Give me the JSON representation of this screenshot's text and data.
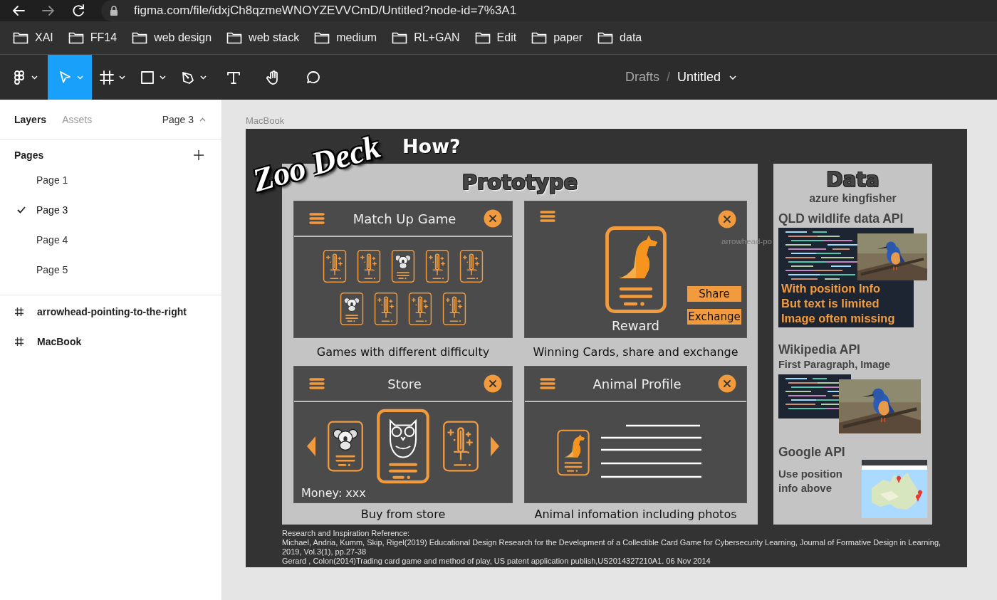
{
  "browser": {
    "url": "figma.com/file/idxjCh8qzmeWNOYZEVVCmD/Untitled?node-id=7%3A1",
    "bookmarks": [
      "XAI",
      "FF14",
      "web design",
      "web stack",
      "medium",
      "RL+GAN",
      "Edit",
      "paper",
      "data"
    ]
  },
  "toolbar": {
    "tools": [
      {
        "kind": "main-menu",
        "selected": false,
        "menu": true
      },
      {
        "kind": "move",
        "selected": true,
        "menu": true
      },
      {
        "kind": "frame",
        "selected": false,
        "menu": true
      },
      {
        "kind": "shape",
        "selected": false,
        "menu": true
      },
      {
        "kind": "pen",
        "selected": false,
        "menu": true
      },
      {
        "kind": "text",
        "selected": false,
        "menu": false
      },
      {
        "kind": "hand",
        "selected": false,
        "menu": false
      },
      {
        "kind": "comment",
        "selected": false,
        "menu": false
      }
    ],
    "breadcrumb": {
      "folder": "Drafts",
      "separator": "/",
      "file": "Untitled"
    }
  },
  "left_panel": {
    "tabs": [
      {
        "label": "Layers",
        "selected": true
      },
      {
        "label": "Assets",
        "selected": false
      }
    ],
    "page_switcher": "Page 3",
    "pages_heading": "Pages",
    "pages": [
      {
        "label": "Page 1",
        "selected": false
      },
      {
        "label": "Page 3",
        "selected": true
      },
      {
        "label": "Page 4",
        "selected": false
      },
      {
        "label": "Page 5",
        "selected": false
      }
    ],
    "layers": [
      "arrowhead-pointing-to-the-right",
      "MacBook"
    ]
  },
  "canvas": {
    "frame_label": "MacBook",
    "overlay_label": "arrowhead-po",
    "slide": {
      "logo": "Zoo Deck",
      "heading": "How?",
      "prototype": {
        "title": "Prototype",
        "screens": [
          {
            "kind": "match",
            "title": "Match Up Game",
            "caption": "Games with different difficulty"
          },
          {
            "kind": "reward",
            "label": "Reward",
            "buttons": [
              "Share",
              "Exchange"
            ],
            "caption": "Winning Cards, share and exchange"
          },
          {
            "kind": "store",
            "title": "Store",
            "money": "Money: xxx",
            "caption": "Buy from store"
          },
          {
            "kind": "profile",
            "title": "Animal Profile",
            "caption": "Animal infomation including photos"
          }
        ]
      },
      "data": {
        "title": "Data",
        "subtitle": "azure kingfisher",
        "sections": [
          {
            "kind": "qld",
            "title": "QLD wildlife data API",
            "note": [
              "With position Info",
              "But text is limited",
              "Image often missing"
            ]
          },
          {
            "kind": "wiki",
            "title": "Wikipedia API",
            "subtitle": "First Paragraph, Image"
          },
          {
            "kind": "map",
            "title": "Google API",
            "subtitle": "Use position info above"
          }
        ]
      },
      "references": {
        "heading": "Research and Inspiration Reference:",
        "entries": [
          "Michael, Andria, Kumm, Skip, Rigel(2019) Educational Design Research for the Development of a Collectible Card Game for Cybersecurity Learning, Journal of Formative Design in Learning, 2019, Vol.3(1), pp.27-38",
          "Gerard , Colon(2014)Trading card game and method of play, US patent application publish,US2014327210A1. 06 Nov 2014"
        ]
      }
    }
  }
}
